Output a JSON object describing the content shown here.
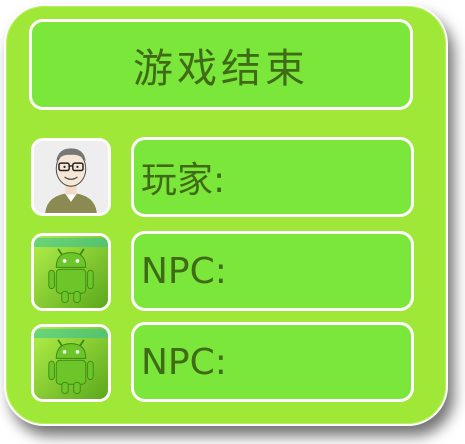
{
  "dialog": {
    "title": "游戏结束"
  },
  "players": [
    {
      "label": "玩家:",
      "avatar_icon": "person-glasses-avatar-icon"
    },
    {
      "label": "NPC:",
      "avatar_icon": "android-robot-icon"
    },
    {
      "label": "NPC:",
      "avatar_icon": "android-robot-icon"
    }
  ],
  "colors": {
    "panel_bg": "#9fe838",
    "box_bg": "#7be73b",
    "text": "#3f6b16",
    "border": "#ffffff"
  }
}
